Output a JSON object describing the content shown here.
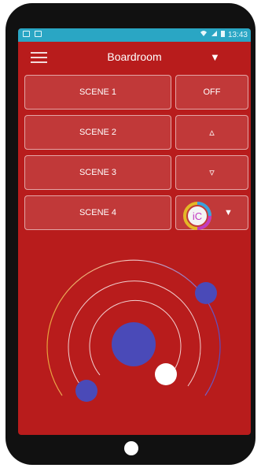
{
  "status": {
    "time": "13:43",
    "left_icons": [
      "gallery-icon",
      "notification-icon"
    ],
    "right_icons": [
      "wifi-icon",
      "signal-icon",
      "battery-icon"
    ]
  },
  "topbar": {
    "room": "Boardroom",
    "caret": "▼"
  },
  "scenes": [
    "SCENE 1",
    "SCENE 2",
    "SCENE 3",
    "SCENE 4"
  ],
  "controls": {
    "off": "OFF",
    "up": "▵",
    "down": "▿",
    "selector_caret": "▼"
  },
  "logo": {
    "text": "iC"
  },
  "colors": {
    "accent_red": "#b81c1c",
    "status_bar": "#2aa6c4",
    "knob_blue": "#4a4ab8",
    "knob_white": "#ffffff"
  }
}
